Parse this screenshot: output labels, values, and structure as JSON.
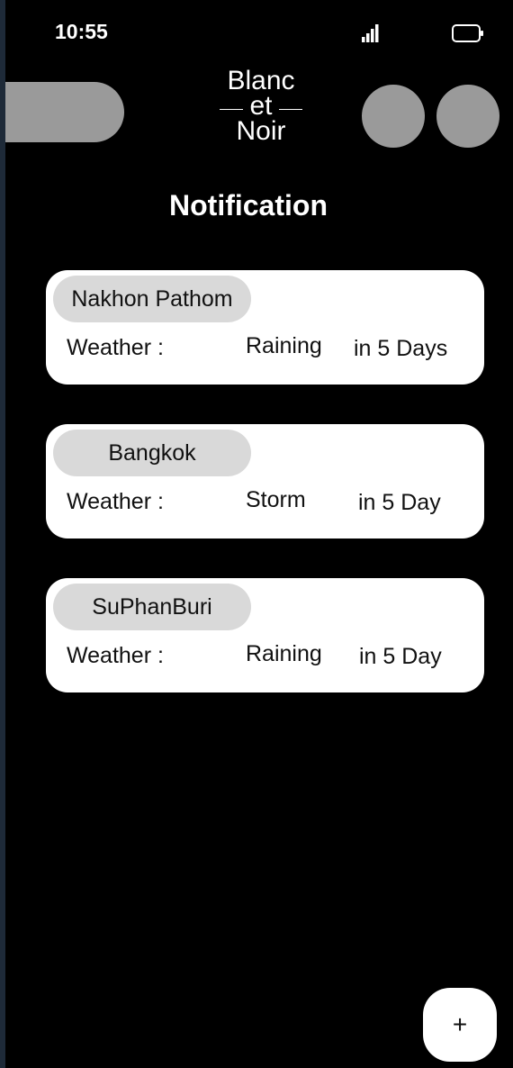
{
  "status_bar": {
    "time": "10:55"
  },
  "header": {
    "logo_line1": "Blanc",
    "logo_line2": "et",
    "logo_line3": "Noir"
  },
  "page": {
    "title": "Notification"
  },
  "notifications": [
    {
      "city": "Nakhon Pathom",
      "label": "Weather :",
      "condition": "Raining",
      "when": "in 5 Days"
    },
    {
      "city": "Bangkok",
      "label": "Weather :",
      "condition": "Storm",
      "when": "in 5 Day"
    },
    {
      "city": "SuPhanBuri",
      "label": "Weather :",
      "condition": "Raining",
      "when": "in 5 Day"
    }
  ],
  "fab": {
    "label": "+"
  },
  "colors": {
    "background": "#000000",
    "card": "#ffffff",
    "chip": "#d9d9d9",
    "placeholder_gray": "#9a9a9a"
  },
  "icons": [
    "signal-icon",
    "battery-icon"
  ]
}
